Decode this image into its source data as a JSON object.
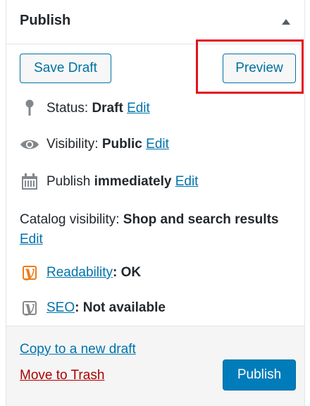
{
  "panel": {
    "title": "Publish"
  },
  "actions": {
    "save_draft": "Save Draft",
    "preview": "Preview"
  },
  "status": {
    "label": "Status:",
    "value": "Draft",
    "edit": "Edit"
  },
  "visibility": {
    "label": "Visibility:",
    "value": "Public",
    "edit": "Edit"
  },
  "schedule": {
    "label": "Publish",
    "value": "immediately",
    "edit": "Edit"
  },
  "catalog": {
    "label": "Catalog visibility:",
    "value": "Shop and search results",
    "edit": "Edit"
  },
  "readability": {
    "link": "Readability",
    "value": ": OK",
    "color": "#ee7c1b"
  },
  "seo": {
    "link": "SEO",
    "value": ": Not available",
    "color": "#888888"
  },
  "footer": {
    "copy_draft": "Copy to a new draft",
    "move_trash": "Move to Trash",
    "publish": "Publish"
  },
  "colors": {
    "accent": "#0071a1",
    "primary_button": "#007cba",
    "highlight": "#e2131c",
    "trash": "#aa0000"
  },
  "icons": {
    "status": "pin-icon",
    "visibility": "eye-icon",
    "schedule": "calendar-icon",
    "readability": "yoast-readability-icon",
    "seo": "yoast-seo-icon"
  }
}
